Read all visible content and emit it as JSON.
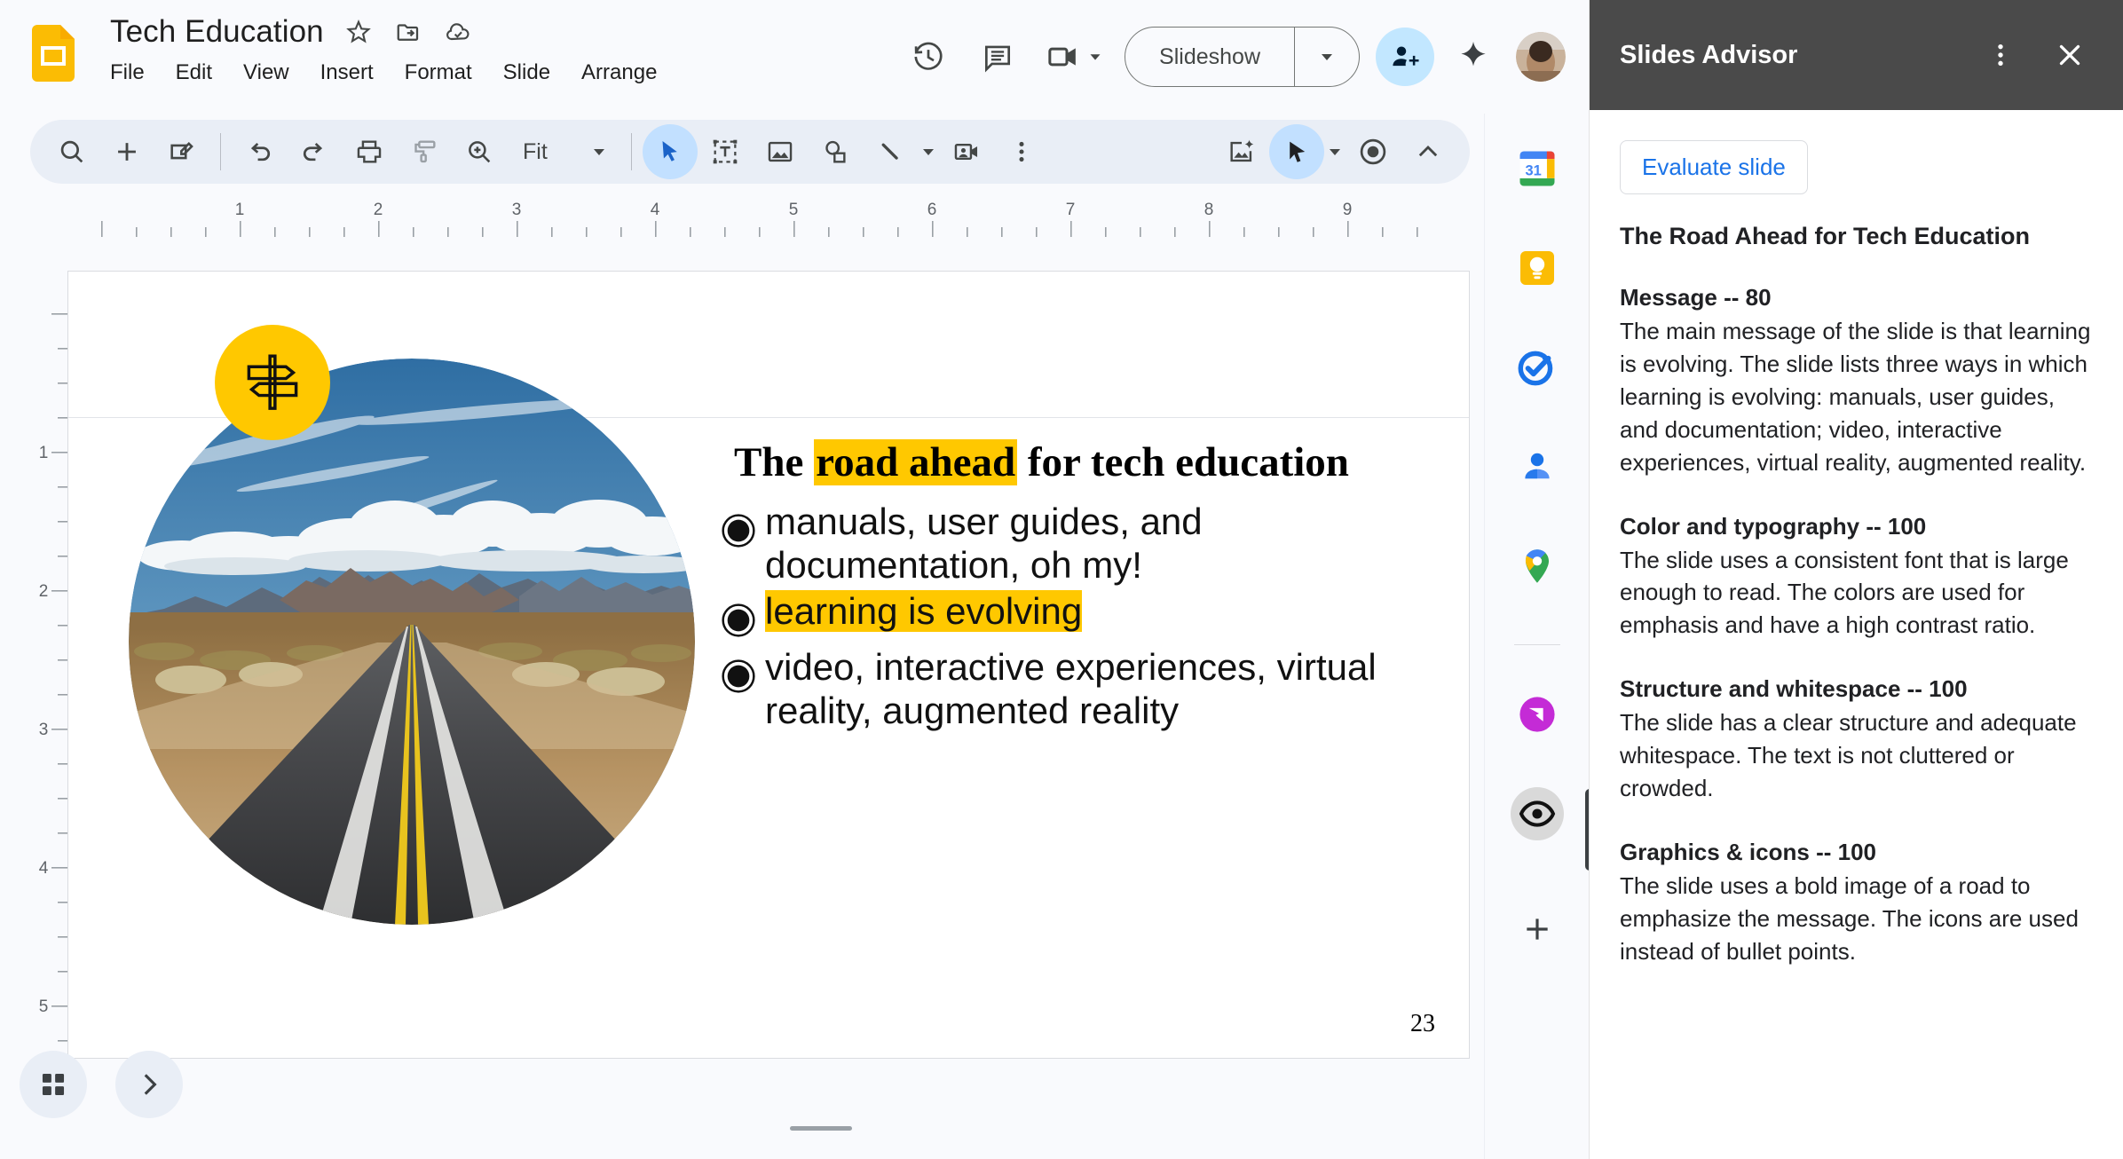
{
  "header": {
    "doc_title": "Tech Education",
    "icons": [
      "star-icon",
      "move-to-folder-icon",
      "cloud-saved-icon"
    ],
    "menu": [
      "File",
      "Edit",
      "View",
      "Insert",
      "Format",
      "Slide",
      "Arrange"
    ],
    "history_icon": "version-history-icon",
    "comment_icon": "comment-icon",
    "meet_icon": "meet-video-icon",
    "slideshow_label": "Slideshow",
    "share_icon": "share-person-add-icon",
    "gemini_icon": "gemini-sparkle-icon",
    "avatar": "user-avatar"
  },
  "toolbar": {
    "zoom_value": "Fit",
    "icons": [
      "search-icon",
      "new-slide-icon",
      "new-slide-layout-icon",
      "undo-icon",
      "redo-icon",
      "print-icon",
      "paint-format-icon",
      "zoom-icon"
    ],
    "tools": [
      "select-tool",
      "text-box-tool",
      "image-tool",
      "shape-tool",
      "line-tool"
    ],
    "right_icons": [
      "video-insert-icon",
      "more-options-icon",
      "ai-image-icon",
      "laser-pointer-tool",
      "record-icon",
      "collapse-toolbar-icon"
    ]
  },
  "ruler": {
    "h_numbers": [
      "1",
      "2",
      "3",
      "4",
      "5",
      "6",
      "7",
      "8",
      "9"
    ],
    "v_numbers": [
      "1",
      "2",
      "3",
      "4",
      "5"
    ]
  },
  "slide": {
    "title_before": "The ",
    "title_highlight": "road ahead",
    "title_after": " for tech education",
    "bullets": [
      {
        "text": "manuals, user guides, and documentation, oh my!",
        "highlighted": false
      },
      {
        "text": "learning is evolving",
        "highlighted": true
      },
      {
        "text": "video, interactive experiences, virtual reality, augmented reality",
        "highlighted": false
      }
    ],
    "slide_number": "23",
    "badge_icon": "signpost-icon",
    "image_alt": "desert-road-photo",
    "highlight_color": "#FFC800"
  },
  "bottom": {
    "grid_view_icon": "grid-view-icon",
    "next_icon": "chevron-right-icon"
  },
  "rail": {
    "items": [
      {
        "name": "calendar",
        "label": "31"
      },
      {
        "name": "keep",
        "label": ""
      },
      {
        "name": "tasks",
        "label": ""
      },
      {
        "name": "contacts",
        "label": ""
      },
      {
        "name": "maps",
        "label": ""
      },
      {
        "name": "purple-app",
        "label": ""
      },
      {
        "name": "slides-advisor",
        "label": ""
      }
    ],
    "add_icon": "add-apps-icon"
  },
  "advisor": {
    "panel_title": "Slides Advisor",
    "more_icon": "more-vert-icon",
    "close_icon": "close-icon",
    "evaluate_button": "Evaluate slide",
    "doc_title": "The Road Ahead for Tech Education",
    "sections": [
      {
        "heading": "Message -- 80",
        "body": "The main message of the slide is that learning is evolving. The slide lists three ways in which learning is evolving: manuals, user guides, and documentation; video, interactive experiences, virtual reality, augmented reality."
      },
      {
        "heading": "Color and typography -- 100",
        "body": "The slide uses a consistent font that is large enough to read. The colors are used for emphasis and have a high contrast ratio."
      },
      {
        "heading": "Structure and whitespace -- 100",
        "body": "The slide has a clear structure and adequate whitespace. The text is not cluttered or crowded."
      },
      {
        "heading": "Graphics & icons -- 100",
        "body": "The slide uses a bold image of a road to emphasize the message. The icons are used instead of bullet points."
      }
    ]
  }
}
